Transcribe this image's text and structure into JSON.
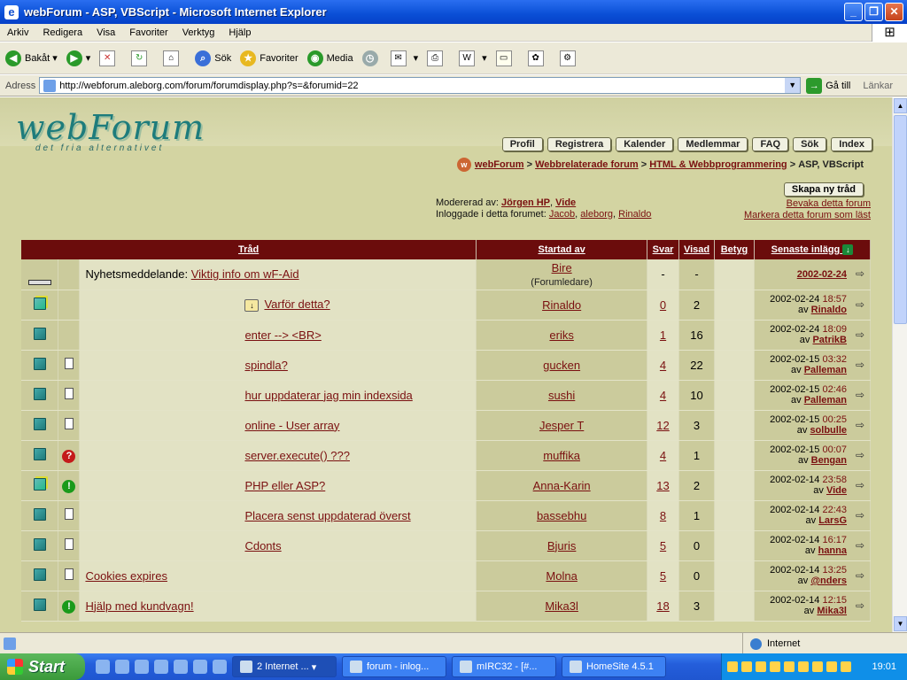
{
  "window": {
    "title": "webForum - ASP, VBScript - Microsoft Internet Explorer"
  },
  "menu": [
    "Arkiv",
    "Redigera",
    "Visa",
    "Favoriter",
    "Verktyg",
    "Hjälp"
  ],
  "toolbar": {
    "back": "Bakåt",
    "search": "Sök",
    "favorites": "Favoriter",
    "media": "Media"
  },
  "address": {
    "label": "Adress",
    "url": "http://webforum.aleborg.com/forum/forumdisplay.php?s=&forumid=22",
    "go": "Gå till",
    "links": "Länkar"
  },
  "forum": {
    "logo": "webForum",
    "tagline": "det fria alternativet",
    "nav": [
      "Profil",
      "Registrera",
      "Kalender",
      "Medlemmar",
      "FAQ",
      "Sök",
      "Index"
    ],
    "breadcrumb": {
      "home": "webForum",
      "sep": ">",
      "cat": "Webbrelaterade forum",
      "sub": "HTML & Webbprogrammering",
      "current": "ASP, VBScript"
    },
    "new_thread": "Skapa ny tråd",
    "moderated_label": "Modererad av:",
    "moderators": [
      "Jörgen HP",
      "Vide"
    ],
    "logged_label": "Inloggade i detta forumet:",
    "logged": [
      "Jacob",
      "aleborg",
      "Rinaldo"
    ],
    "watch": "Bevaka detta forum",
    "mark_read": "Markera detta forum som läst",
    "headers": {
      "thread": "Tråd",
      "started": "Startad av",
      "replies": "Svar",
      "views": "Visad",
      "rating": "Betyg",
      "last": "Senaste inlägg"
    },
    "announcement": {
      "prefix": "Nyhetsmeddelande:",
      "title": "Viktig info om wF-Aid",
      "author": "Bire",
      "role": "(Forumledare)",
      "replies": "-",
      "views": "-",
      "date": "2002-02-24"
    },
    "threads": [
      {
        "icon": "hot-folder-icon",
        "status": "",
        "note": true,
        "title": "Varför detta?",
        "author": "Rinaldo",
        "replies": "0",
        "views": "2",
        "date": "2002-02-24",
        "time": "18:57",
        "by": "Rinaldo",
        "indent": true
      },
      {
        "icon": "folder-icon",
        "status": "",
        "note": false,
        "title": "enter --> <BR>",
        "author": "eriks",
        "replies": "1",
        "views": "16",
        "date": "2002-02-24",
        "time": "18:09",
        "by": "PatrikB",
        "indent": true
      },
      {
        "icon": "folder-icon",
        "status": "page",
        "note": false,
        "title": "spindla?",
        "author": "gucken",
        "replies": "4",
        "views": "22",
        "date": "2002-02-15",
        "time": "03:32",
        "by": "Palleman",
        "indent": true
      },
      {
        "icon": "folder-icon",
        "status": "page",
        "note": false,
        "title": "hur uppdaterar jag min indexsida",
        "author": "sushi",
        "replies": "4",
        "views": "10",
        "date": "2002-02-15",
        "time": "02:46",
        "by": "Palleman",
        "indent": true
      },
      {
        "icon": "folder-icon",
        "status": "page",
        "note": false,
        "title": "online - User array",
        "author": "Jesper T",
        "replies": "12",
        "views": "3",
        "date": "2002-02-15",
        "time": "00:25",
        "by": "solbulle",
        "indent": true
      },
      {
        "icon": "folder-icon",
        "status": "question",
        "note": false,
        "title": "server.execute() ???",
        "author": "muffika",
        "replies": "4",
        "views": "1",
        "date": "2002-02-15",
        "time": "00:07",
        "by": "Bengan",
        "indent": true
      },
      {
        "icon": "hot-folder-icon",
        "status": "exclaim",
        "note": false,
        "title": "PHP eller ASP?",
        "author": "Anna-Karin",
        "replies": "13",
        "views": "2",
        "date": "2002-02-14",
        "time": "23:58",
        "by": "Vide",
        "indent": true
      },
      {
        "icon": "folder-icon",
        "status": "page",
        "note": false,
        "title": "Placera senst uppdaterad överst",
        "author": "bassebhu",
        "replies": "8",
        "views": "1",
        "date": "2002-02-14",
        "time": "22:43",
        "by": "LarsG",
        "indent": true
      },
      {
        "icon": "folder-icon",
        "status": "page",
        "note": false,
        "title": "Cdonts",
        "author": "Bjuris",
        "replies": "5",
        "views": "0",
        "date": "2002-02-14",
        "time": "16:17",
        "by": "hanna",
        "indent": true
      },
      {
        "icon": "folder-icon",
        "status": "page",
        "note": false,
        "title": "Cookies expires",
        "author": "Molna",
        "replies": "5",
        "views": "0",
        "date": "2002-02-14",
        "time": "13:25",
        "by": "@nders",
        "indent": false
      },
      {
        "icon": "folder-icon",
        "status": "exclaim",
        "note": false,
        "title": "Hjälp med kundvagn!",
        "author": "Mika3l",
        "replies": "18",
        "views": "3",
        "date": "2002-02-14",
        "time": "12:15",
        "by": "Mika3l",
        "indent": false
      }
    ],
    "by_label": "av"
  },
  "status": {
    "zone": "Internet"
  },
  "taskbar": {
    "start": "Start",
    "tasks": [
      "2 Internet ...",
      "forum - inlog...",
      "mIRC32 - [#...",
      "HomeSite 4.5.1"
    ],
    "clock": "19:01"
  }
}
